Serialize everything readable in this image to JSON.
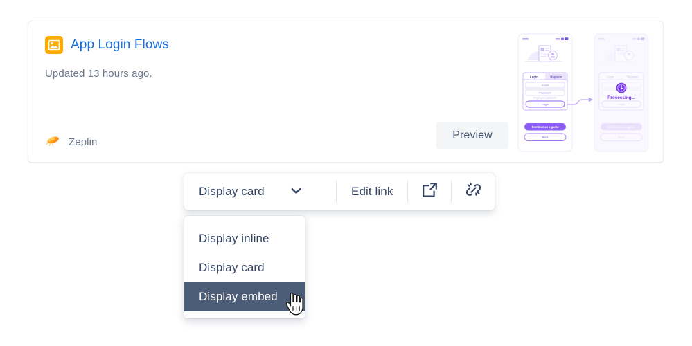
{
  "card": {
    "icon": "image-icon",
    "title": "App Login Flows",
    "subtitle": "Updated 13 hours ago.",
    "provider_icon": "zeplin-logo",
    "provider_name": "Zeplin",
    "preview_button_label": "Preview",
    "icon_color": "#ffab00",
    "title_color": "#1a6fe0",
    "subtitle_color": "#6b778c"
  },
  "thumbnail": {
    "accent_color": "#8b5cf6",
    "screen_one": {
      "status_time": "9:41",
      "tab_login": "Login",
      "tab_register": "Register",
      "field_email": "Email",
      "field_password": "Password",
      "forgot_link": "Forgot your password?",
      "button_login": "Login",
      "button_guest": "Continue as a guest",
      "button_back": "Back"
    },
    "screen_two": {
      "status_time": "9:41",
      "tab_login": "Login",
      "tab_register": "Register",
      "processing_label": "Processing...",
      "button_login": "Login",
      "button_guest": "Continue as a guest",
      "button_back": "Back"
    }
  },
  "toolbar": {
    "display_select_value": "Display card",
    "chevron_icon": "chevron-down-icon",
    "edit_link_label": "Edit link",
    "open_in_new_icon": "open-in-new-icon",
    "unlink_icon": "unlink-icon"
  },
  "menu": {
    "items": [
      {
        "label": "Display inline",
        "selected": false
      },
      {
        "label": "Display card",
        "selected": false
      },
      {
        "label": "Display embed",
        "selected": true
      }
    ],
    "highlight_color": "#4c5d78"
  },
  "cursor": {
    "icon": "pointer-hand-cursor"
  }
}
